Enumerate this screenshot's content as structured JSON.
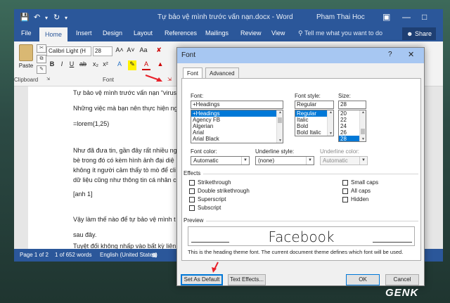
{
  "window": {
    "title": "Tự bảo vệ mình trước vấn nạn.docx - Word",
    "user": "Pham Thai Hoc"
  },
  "menu": {
    "items": [
      "File",
      "Home",
      "Insert",
      "Design",
      "Layout",
      "References",
      "Mailings",
      "Review",
      "View"
    ],
    "tell_me": "Tell me what you want to do",
    "share": "Share"
  },
  "ribbon": {
    "paste": "Paste",
    "font_name": "Calibri Light (H",
    "font_size": "28",
    "clipboard_label": "Clipboard",
    "font_label": "Font"
  },
  "document": {
    "lines": [
      "Tự bảo vệ mình trước vấn nạn “virus",
      "Những việc mà bạn nên thực hiện ng",
      "=lorem(1,25)",
      "Như đã đưa tin, gần đây rất nhiều ng",
      "bè trong đó có kèm hình ảnh đại diệ",
      "không ít người cảm thấy tò mò để cli",
      "dữ liệu cũng như thông tin cá nhân c",
      "[anh 1]",
      "Vậy làm thế nào để tự bảo vệ mình t",
      "sau đây.",
      "Tuyệt đối không nhấp vào bất kỳ liên"
    ]
  },
  "status": {
    "page": "Page 1 of 2",
    "words": "1 of 652 words",
    "language": "English (United States)"
  },
  "dialog": {
    "title": "Font",
    "help": "?",
    "tabs": [
      "Font",
      "Advanced"
    ],
    "font_label": "Font:",
    "font_value": "+Headings",
    "font_list": [
      "+Headings",
      "Agency FB",
      "Algerian",
      "Arial",
      "Arial Black"
    ],
    "style_label": "Font style:",
    "style_value": "Regular",
    "style_list": [
      "Regular",
      "Italic",
      "Bold",
      "Bold Italic"
    ],
    "size_label": "Size:",
    "size_value": "28",
    "size_list": [
      "20",
      "22",
      "24",
      "26",
      "28"
    ],
    "font_color_label": "Font color:",
    "font_color_value": "Automatic",
    "underline_style_label": "Underline style:",
    "underline_style_value": "(none)",
    "underline_color_label": "Underline color:",
    "underline_color_value": "Automatic",
    "effects_label": "Effects",
    "effects_left": [
      "Strikethrough",
      "Double strikethrough",
      "Superscript",
      "Subscript"
    ],
    "effects_right": [
      "Small caps",
      "All caps",
      "Hidden"
    ],
    "preview_label": "Preview",
    "preview_text": "Facebook",
    "preview_note": "This is the heading theme font. The current document theme defines which font will be used.",
    "buttons": {
      "set_default": "Set As Default",
      "text_effects": "Text Effects...",
      "ok": "OK",
      "cancel": "Cancel"
    }
  },
  "watermark": "GENK",
  "colors": {
    "word_blue": "#2b579a",
    "dialog_title": "#a7c7f2",
    "selection": "#0078d7",
    "annotation_red": "#e8202a"
  }
}
